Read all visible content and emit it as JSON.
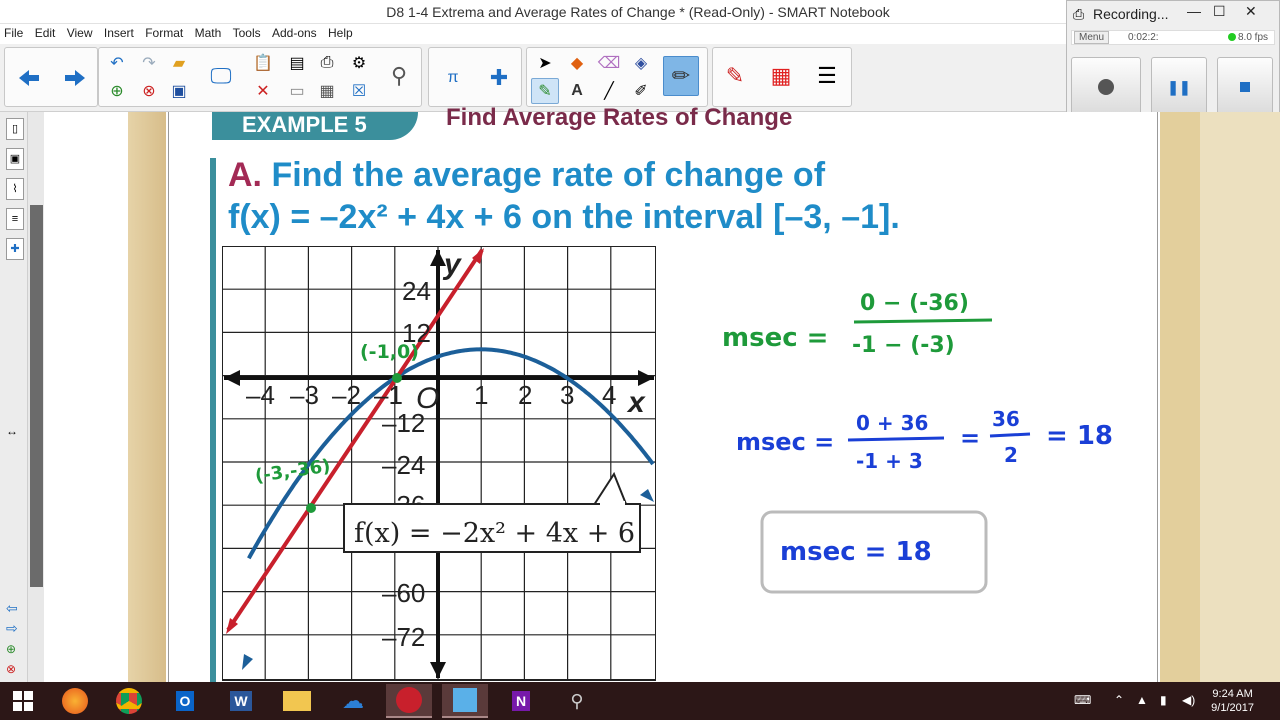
{
  "window": {
    "title": "D8 1-4 Extrema and Average Rates of Change * (Read-Only) - SMART Notebook"
  },
  "menu": [
    "File",
    "Edit",
    "View",
    "Insert",
    "Format",
    "Math",
    "Tools",
    "Add-ons",
    "Help"
  ],
  "recorder": {
    "title": "Recording...",
    "menu_label": "Menu",
    "time": "0:02:2:",
    "fps": "8.0 fps"
  },
  "slide": {
    "banner": "EXAMPLE 5",
    "heading": "Find Average Rates of Change",
    "question_letter": "A.",
    "question_line1": "Find the average rate of change of",
    "question_line2": "f(x) = –2x² + 4x + 6 on the interval [–3, –1].",
    "graph": {
      "x_ticks": [
        "–4",
        "–3",
        "–2",
        "–1",
        "O",
        "1",
        "2",
        "3",
        "4"
      ],
      "y_ticks": [
        "24",
        "12",
        "–12",
        "–24",
        "–36",
        "–60",
        "–72"
      ],
      "x_label": "x",
      "y_label": "y",
      "function_label": "f(x) = −2x² + 4x + 6",
      "point1_label": "(-1,0)",
      "point2_label": "(-3,-36)"
    },
    "handwriting": {
      "line1_lhs": "msec =",
      "line1_num": "0 − (-36)",
      "line1_den": "-1 − (-3)",
      "line2_lhs": "msec =",
      "line2_num": "0 + 36",
      "line2_den": "-1 + 3",
      "line2_eq": "=",
      "line2_frac_num": "36",
      "line2_frac_den": "2",
      "line2_result": "= 18",
      "boxed": "msec = 18"
    }
  },
  "taskbar": {
    "time": "9:24 AM",
    "date": "9/1/2017"
  },
  "colors": {
    "accent_blue": "#1f8cc8",
    "teal": "#3b8f9c",
    "maroon": "#a32a55",
    "ink_green": "#1e9a3a",
    "ink_blue": "#1a3fd6",
    "curve_blue": "#1c5f99",
    "line_red": "#c8202c"
  }
}
